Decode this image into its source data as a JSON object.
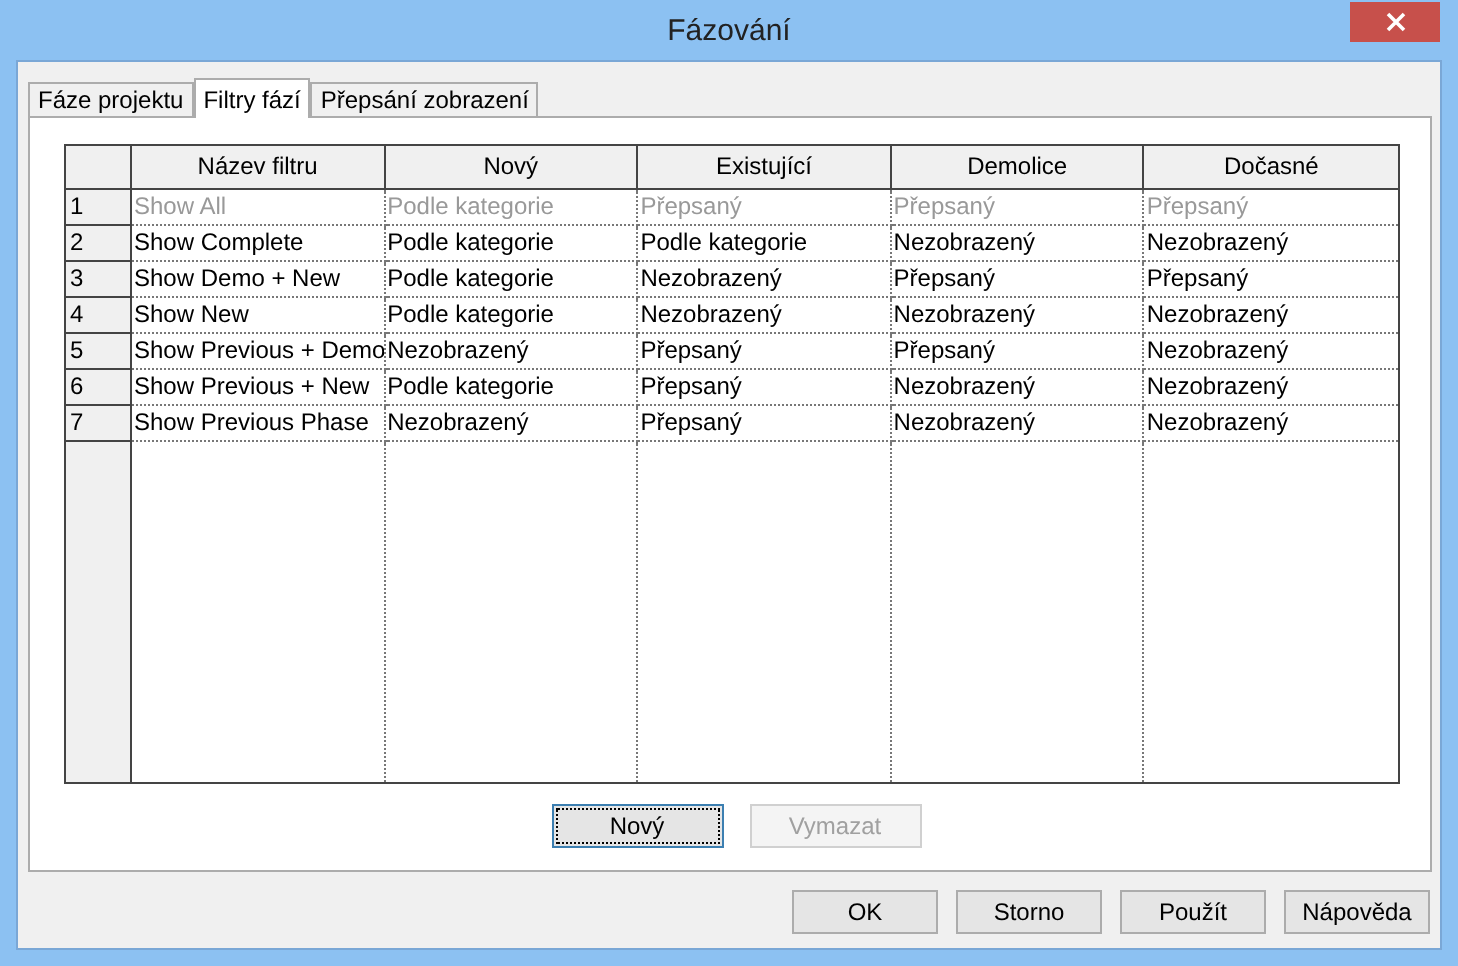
{
  "window": {
    "title": "Fázování"
  },
  "tabs": [
    {
      "label": "Fáze projektu",
      "selected": false
    },
    {
      "label": "Filtry fází",
      "selected": true
    },
    {
      "label": "Přepsání zobrazení",
      "selected": false
    }
  ],
  "table": {
    "columns": [
      "Název filtru",
      "Nový",
      "Existující",
      "Demolice",
      "Dočasné"
    ],
    "rows": [
      {
        "number": "1",
        "disabled": true,
        "cells": [
          "Show All",
          "Podle kategorie",
          "Přepsaný",
          "Přepsaný",
          "Přepsaný"
        ]
      },
      {
        "number": "2",
        "disabled": false,
        "cells": [
          "Show Complete",
          "Podle kategorie",
          "Podle kategorie",
          "Nezobrazený",
          "Nezobrazený"
        ]
      },
      {
        "number": "3",
        "disabled": false,
        "cells": [
          "Show Demo + New",
          "Podle kategorie",
          "Nezobrazený",
          "Přepsaný",
          "Přepsaný"
        ]
      },
      {
        "number": "4",
        "disabled": false,
        "cells": [
          "Show New",
          "Podle kategorie",
          "Nezobrazený",
          "Nezobrazený",
          "Nezobrazený"
        ]
      },
      {
        "number": "5",
        "disabled": false,
        "cells": [
          "Show Previous + Demo",
          "Nezobrazený",
          "Přepsaný",
          "Přepsaný",
          "Nezobrazený"
        ]
      },
      {
        "number": "6",
        "disabled": false,
        "cells": [
          "Show Previous + New",
          "Podle kategorie",
          "Přepsaný",
          "Nezobrazený",
          "Nezobrazený"
        ]
      },
      {
        "number": "7",
        "disabled": false,
        "cells": [
          "Show Previous Phase",
          "Nezobrazený",
          "Přepsaný",
          "Nezobrazený",
          "Nezobrazený"
        ]
      }
    ]
  },
  "table_buttons": [
    {
      "label": "Nový",
      "disabled": false
    },
    {
      "label": "Vymazat",
      "disabled": true
    }
  ],
  "buttons": [
    "OK",
    "Storno",
    "Použít",
    "Nápověda"
  ]
}
